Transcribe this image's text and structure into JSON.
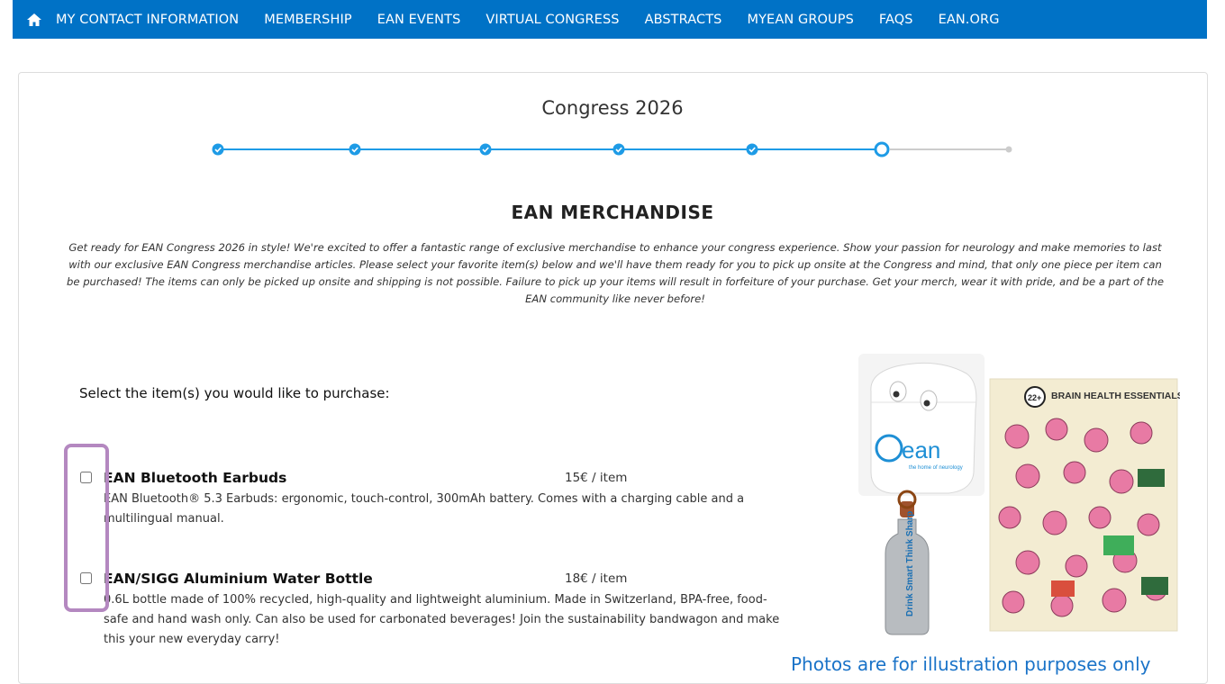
{
  "nav": {
    "items": [
      {
        "label": "MY CONTACT INFORMATION"
      },
      {
        "label": "MEMBERSHIP"
      },
      {
        "label": "EAN EVENTS"
      },
      {
        "label": "VIRTUAL CONGRESS"
      },
      {
        "label": "ABSTRACTS"
      },
      {
        "label": "MYEAN GROUPS"
      },
      {
        "label": "FAQS"
      },
      {
        "label": "EAN.ORG"
      }
    ]
  },
  "page": {
    "title": "Congress 2026",
    "section_title": "EAN MERCHANDISE",
    "intro": "Get ready for EAN Congress 2026 in style! We're excited to offer a fantastic range of exclusive merchandise to enhance your congress experience. Show your passion for neurology and make memories to last with our exclusive EAN Congress merchandise articles. Please select your favorite item(s) below and we'll have them ready for you to pick up onsite at the Congress and mind, that only one piece per item can be purchased! The items can only be picked up onsite and shipping is not possible. Failure to pick up your items will result in forfeiture of your purchase. Get your merch, wear it with pride, and be a part of the EAN community like never before!",
    "select_heading": "Select the item(s) you would like to purchase:",
    "photo_note": "Photos are for illustration purposes only"
  },
  "stepper": {
    "completed_steps": 5,
    "current_step": 6,
    "total_steps": 7
  },
  "items": [
    {
      "name": "EAN Bluetooth Earbuds",
      "price": "15€ / item",
      "description": "EAN Bluetooth® 5.3 Earbuds: ergonomic, touch-control, 300mAh battery. Comes with a charging cable and a multilingual manual.",
      "checked": false
    },
    {
      "name": "EAN/SIGG Aluminium Water Bottle",
      "price": "18€ / item",
      "description": "0.6L bottle made of 100% recycled, high-quality and lightweight aluminium. Made in Switzerland, BPA-free, food-safe and hand wash only. Can also be used for carbonated beverages! Join the sustainability bandwagon and make this your new everyday carry!",
      "checked": false
    }
  ],
  "photos": {
    "earbuds_logo": "ean",
    "earbuds_tagline": "the home of neurology",
    "bottle_text": "Drink Smart Think Sharp",
    "poster_title": "BRAIN HEALTH ESSENTIALS",
    "poster_badge": "22+"
  },
  "colors": {
    "nav_bg": "#0072c6",
    "accent": "#1e9be6",
    "highlight": "#b488c0"
  }
}
